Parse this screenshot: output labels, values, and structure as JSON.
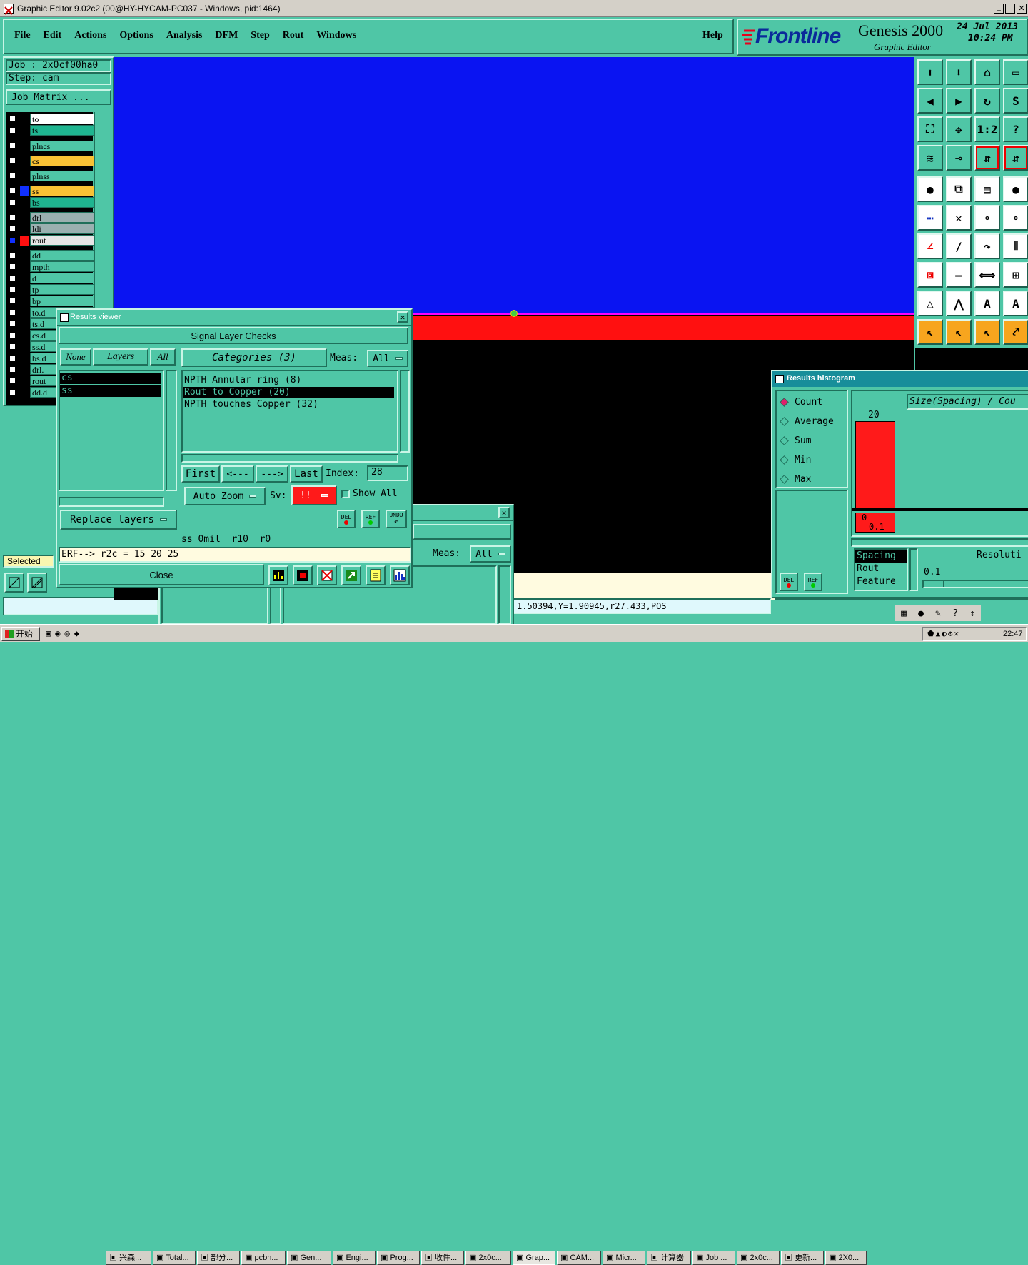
{
  "window": {
    "title": "Graphic Editor 9.02c2 (00@HY-HYCAM-PC037 - Windows, pid:1464)"
  },
  "menu": {
    "items": [
      "File",
      "Edit",
      "Actions",
      "Options",
      "Analysis",
      "DFM",
      "Step",
      "Rout",
      "Windows"
    ],
    "help": "Help"
  },
  "brand": {
    "logo": "Frontline",
    "product": "Genesis 2000",
    "subtitle": "Graphic Editor",
    "date": "24 Jul 2013",
    "time": "10:24 PM"
  },
  "job": {
    "job_label": "Job : 2x0cf00ha0",
    "step_label": "Step: cam",
    "matrix_button": "Job Matrix ..."
  },
  "layers": [
    {
      "name": "to",
      "color": "#ffffff",
      "marker": ""
    },
    {
      "name": "ts",
      "color": "#1fb590",
      "marker": ""
    },
    {
      "name": "plncs",
      "color": "#4fc6a6",
      "marker": ""
    },
    {
      "name": "cs",
      "color": "#f9c235",
      "marker": ""
    },
    {
      "name": "plnss",
      "color": "#4fc6a6",
      "marker": ""
    },
    {
      "name": "ss",
      "color": "#f9c235",
      "marker": "#1030ff"
    },
    {
      "name": "bs",
      "color": "#1fb590",
      "marker": ""
    },
    {
      "name": "drl",
      "color": "#9ab0b0",
      "marker": ""
    },
    {
      "name": "ldi",
      "color": "#9ab0b0",
      "marker": ""
    },
    {
      "name": "rout",
      "color": "#e6e6e6",
      "marker": "#ff1010"
    },
    {
      "name": "dd",
      "color": "#4fc6a6",
      "marker": ""
    },
    {
      "name": "mpth",
      "color": "#4fc6a6",
      "marker": ""
    },
    {
      "name": "d",
      "color": "#4fc6a6",
      "marker": ""
    },
    {
      "name": "tp",
      "color": "#4fc6a6",
      "marker": ""
    },
    {
      "name": "bp",
      "color": "#4fc6a6",
      "marker": ""
    },
    {
      "name": "to.d",
      "color": "#4fc6a6",
      "marker": ""
    },
    {
      "name": "ts.d",
      "color": "#4fc6a6",
      "marker": ""
    },
    {
      "name": "cs.d",
      "color": "#4fc6a6",
      "marker": ""
    },
    {
      "name": "ss.d",
      "color": "#4fc6a6",
      "marker": ""
    },
    {
      "name": "bs.d",
      "color": "#4fc6a6",
      "marker": ""
    },
    {
      "name": "drl.",
      "color": "#4fc6a6",
      "marker": ""
    },
    {
      "name": "rout",
      "color": "#4fc6a6",
      "marker": ""
    },
    {
      "name": "dd.d",
      "color": "#4fc6a6",
      "marker": ""
    }
  ],
  "left_status": {
    "selected": "Selected"
  },
  "results_viewer": {
    "title": "Results viewer",
    "heading": "Signal Layer Checks",
    "none_btn": "None",
    "layers_btn": "Layers",
    "all_btn": "All",
    "categories_btn": "Categories (3)",
    "meas_label": "Meas:",
    "meas_value": "All",
    "layer_list": [
      "cs",
      "ss"
    ],
    "categories": [
      "NPTH Annular ring (8)",
      "Rout to Copper (20)",
      "NPTH touches Copper (32)"
    ],
    "nav": {
      "first": "First",
      "prev": "<---",
      "next": "--->",
      "last": "Last",
      "index_label": "Index:",
      "index_value": "28"
    },
    "auto_zoom": "Auto Zoom",
    "sv_label": "Sv:",
    "sv_value": "!!",
    "show_all": "Show All",
    "replace_layers": "Replace layers",
    "del": "DEL",
    "ref": "REF",
    "undo": "UNDO",
    "info": "ss 0mil  r10  r0",
    "erf": "ERF--> r2c = 15 20 25",
    "close": "Close"
  },
  "second_panel": {
    "meas_label": "Meas:",
    "meas_value": "All"
  },
  "coords": "1.50394,Y=1.90945,r27.433,POS",
  "histogram": {
    "title": "Results histogram",
    "options": [
      "Count",
      "Average",
      "Sum",
      "Min",
      "Max"
    ],
    "selected_option": "Count",
    "axis_title": "Size(Spacing) / Cou",
    "bar_value": "20",
    "bin_label": "0-",
    "bin_label2": "0.1",
    "list": [
      "Spacing",
      "Rout",
      "Feature"
    ],
    "resolution_label": "Resoluti",
    "resolution_value": "0.1",
    "del": "DEL",
    "ref": "REF"
  },
  "taskbar": {
    "start": "开始",
    "items": [
      "兴森...",
      "Total...",
      "部分...",
      "pcbn...",
      "Gen...",
      "Engi...",
      "Prog...",
      "收件...",
      "2x0c...",
      "Grap...",
      "CAM...",
      "Micr...",
      "计算器",
      "Job ...",
      "2x0c...",
      "更新...",
      "2X0..."
    ],
    "clock": "22:47"
  }
}
